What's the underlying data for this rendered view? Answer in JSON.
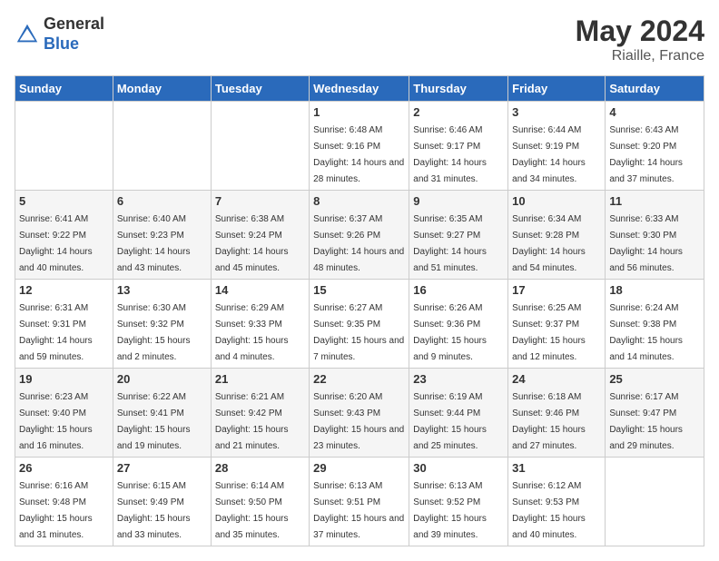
{
  "header": {
    "logo_general": "General",
    "logo_blue": "Blue",
    "month_year": "May 2024",
    "location": "Riaille, France"
  },
  "weekdays": [
    "Sunday",
    "Monday",
    "Tuesday",
    "Wednesday",
    "Thursday",
    "Friday",
    "Saturday"
  ],
  "weeks": [
    [
      {
        "day": "",
        "info": ""
      },
      {
        "day": "",
        "info": ""
      },
      {
        "day": "",
        "info": ""
      },
      {
        "day": "1",
        "info": "Sunrise: 6:48 AM\nSunset: 9:16 PM\nDaylight: 14 hours\nand 28 minutes."
      },
      {
        "day": "2",
        "info": "Sunrise: 6:46 AM\nSunset: 9:17 PM\nDaylight: 14 hours\nand 31 minutes."
      },
      {
        "day": "3",
        "info": "Sunrise: 6:44 AM\nSunset: 9:19 PM\nDaylight: 14 hours\nand 34 minutes."
      },
      {
        "day": "4",
        "info": "Sunrise: 6:43 AM\nSunset: 9:20 PM\nDaylight: 14 hours\nand 37 minutes."
      }
    ],
    [
      {
        "day": "5",
        "info": "Sunrise: 6:41 AM\nSunset: 9:22 PM\nDaylight: 14 hours\nand 40 minutes."
      },
      {
        "day": "6",
        "info": "Sunrise: 6:40 AM\nSunset: 9:23 PM\nDaylight: 14 hours\nand 43 minutes."
      },
      {
        "day": "7",
        "info": "Sunrise: 6:38 AM\nSunset: 9:24 PM\nDaylight: 14 hours\nand 45 minutes."
      },
      {
        "day": "8",
        "info": "Sunrise: 6:37 AM\nSunset: 9:26 PM\nDaylight: 14 hours\nand 48 minutes."
      },
      {
        "day": "9",
        "info": "Sunrise: 6:35 AM\nSunset: 9:27 PM\nDaylight: 14 hours\nand 51 minutes."
      },
      {
        "day": "10",
        "info": "Sunrise: 6:34 AM\nSunset: 9:28 PM\nDaylight: 14 hours\nand 54 minutes."
      },
      {
        "day": "11",
        "info": "Sunrise: 6:33 AM\nSunset: 9:30 PM\nDaylight: 14 hours\nand 56 minutes."
      }
    ],
    [
      {
        "day": "12",
        "info": "Sunrise: 6:31 AM\nSunset: 9:31 PM\nDaylight: 14 hours\nand 59 minutes."
      },
      {
        "day": "13",
        "info": "Sunrise: 6:30 AM\nSunset: 9:32 PM\nDaylight: 15 hours\nand 2 minutes."
      },
      {
        "day": "14",
        "info": "Sunrise: 6:29 AM\nSunset: 9:33 PM\nDaylight: 15 hours\nand 4 minutes."
      },
      {
        "day": "15",
        "info": "Sunrise: 6:27 AM\nSunset: 9:35 PM\nDaylight: 15 hours\nand 7 minutes."
      },
      {
        "day": "16",
        "info": "Sunrise: 6:26 AM\nSunset: 9:36 PM\nDaylight: 15 hours\nand 9 minutes."
      },
      {
        "day": "17",
        "info": "Sunrise: 6:25 AM\nSunset: 9:37 PM\nDaylight: 15 hours\nand 12 minutes."
      },
      {
        "day": "18",
        "info": "Sunrise: 6:24 AM\nSunset: 9:38 PM\nDaylight: 15 hours\nand 14 minutes."
      }
    ],
    [
      {
        "day": "19",
        "info": "Sunrise: 6:23 AM\nSunset: 9:40 PM\nDaylight: 15 hours\nand 16 minutes."
      },
      {
        "day": "20",
        "info": "Sunrise: 6:22 AM\nSunset: 9:41 PM\nDaylight: 15 hours\nand 19 minutes."
      },
      {
        "day": "21",
        "info": "Sunrise: 6:21 AM\nSunset: 9:42 PM\nDaylight: 15 hours\nand 21 minutes."
      },
      {
        "day": "22",
        "info": "Sunrise: 6:20 AM\nSunset: 9:43 PM\nDaylight: 15 hours\nand 23 minutes."
      },
      {
        "day": "23",
        "info": "Sunrise: 6:19 AM\nSunset: 9:44 PM\nDaylight: 15 hours\nand 25 minutes."
      },
      {
        "day": "24",
        "info": "Sunrise: 6:18 AM\nSunset: 9:46 PM\nDaylight: 15 hours\nand 27 minutes."
      },
      {
        "day": "25",
        "info": "Sunrise: 6:17 AM\nSunset: 9:47 PM\nDaylight: 15 hours\nand 29 minutes."
      }
    ],
    [
      {
        "day": "26",
        "info": "Sunrise: 6:16 AM\nSunset: 9:48 PM\nDaylight: 15 hours\nand 31 minutes."
      },
      {
        "day": "27",
        "info": "Sunrise: 6:15 AM\nSunset: 9:49 PM\nDaylight: 15 hours\nand 33 minutes."
      },
      {
        "day": "28",
        "info": "Sunrise: 6:14 AM\nSunset: 9:50 PM\nDaylight: 15 hours\nand 35 minutes."
      },
      {
        "day": "29",
        "info": "Sunrise: 6:13 AM\nSunset: 9:51 PM\nDaylight: 15 hours\nand 37 minutes."
      },
      {
        "day": "30",
        "info": "Sunrise: 6:13 AM\nSunset: 9:52 PM\nDaylight: 15 hours\nand 39 minutes."
      },
      {
        "day": "31",
        "info": "Sunrise: 6:12 AM\nSunset: 9:53 PM\nDaylight: 15 hours\nand 40 minutes."
      },
      {
        "day": "",
        "info": ""
      }
    ]
  ]
}
